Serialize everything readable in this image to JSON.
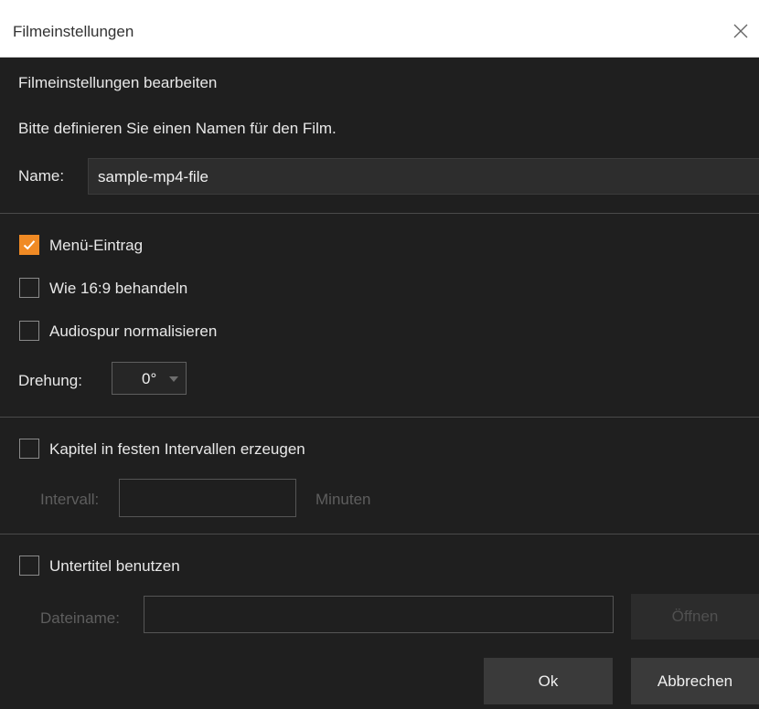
{
  "window": {
    "title": "Filmeinstellungen"
  },
  "heading": "Filmeinstellungen bearbeiten",
  "instruction": "Bitte definieren Sie einen Namen für den Film.",
  "name_field": {
    "label": "Name:",
    "value": "sample-mp4-file"
  },
  "options": {
    "menu_entry": {
      "label": "Menü-Eintrag",
      "checked": true
    },
    "treat_16_9": {
      "label": "Wie 16:9 behandeln",
      "checked": false
    },
    "normalize_audio": {
      "label": "Audiospur normalisieren",
      "checked": false
    }
  },
  "rotation": {
    "label": "Drehung:",
    "value": "0°"
  },
  "chapters": {
    "label": "Kapitel in festen Intervallen erzeugen",
    "checked": false,
    "interval_label": "Intervall:",
    "interval_value": "",
    "unit_label": "Minuten"
  },
  "subtitles": {
    "label": "Untertitel benutzen",
    "checked": false,
    "filename_label": "Dateiname:",
    "filename_value": "",
    "open_label": "Öffnen"
  },
  "buttons": {
    "ok": "Ok",
    "cancel": "Abbrechen"
  },
  "colors": {
    "accent": "#f08a24",
    "background": "#1f1f1f"
  }
}
